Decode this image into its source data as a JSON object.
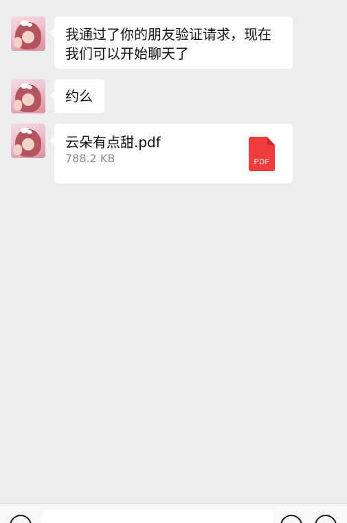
{
  "messages": [
    {
      "type": "text",
      "lines": [
        "我通过了你的朋友验证请求，现在",
        "我们可以开始聊天了"
      ]
    },
    {
      "type": "text",
      "lines": [
        "约么"
      ]
    },
    {
      "type": "file",
      "file_name": "云朵有点甜.pdf",
      "file_size": "788.2 KB",
      "file_icon_label": "PDF"
    }
  ],
  "input_bar": {
    "voice_icon": "voice-icon",
    "emoji_icon": "emoji-icon",
    "plus_icon": "plus-icon"
  },
  "colors": {
    "background": "#ededed",
    "bubble": "#ffffff",
    "pdf_red": "#f03c3c",
    "file_size_gray": "#8a8a8a"
  }
}
